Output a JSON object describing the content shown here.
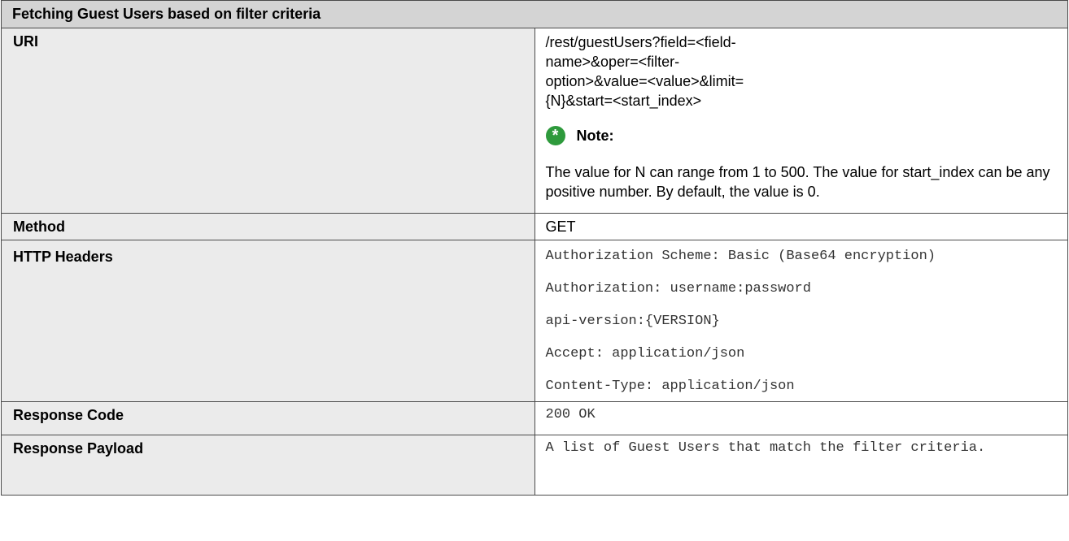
{
  "table": {
    "title": "Fetching Guest Users based on filter criteria",
    "uri": {
      "label": "URI",
      "value": "/rest/guestUsers?field=<field-name>&oper=<filter-option>&value=<value>&limit={N}&start=<start_index>",
      "note_icon": "asterisk-icon",
      "note_title": "Note:",
      "note_text": "The value for N can range from 1 to 500. The value for start_index can be any positive number. By default, the value is 0."
    },
    "method": {
      "label": "Method",
      "value": "GET"
    },
    "http_headers": {
      "label": "HTTP Headers",
      "lines": [
        "Authorization Scheme: Basic (Base64 encryption)",
        "Authorization: username:password",
        "api-version:{VERSION}",
        "Accept: application/json",
        "Content-Type: application/json"
      ]
    },
    "response_code": {
      "label": "Response Code",
      "value": "200 OK"
    },
    "response_payload": {
      "label": "Response Payload",
      "value": "A list of Guest Users that match the filter criteria."
    }
  },
  "colors": {
    "header_bg": "#d4d4d4",
    "label_bg": "#ebebeb",
    "border": "#4a4a4a",
    "note_icon": "#2e9a3c"
  }
}
